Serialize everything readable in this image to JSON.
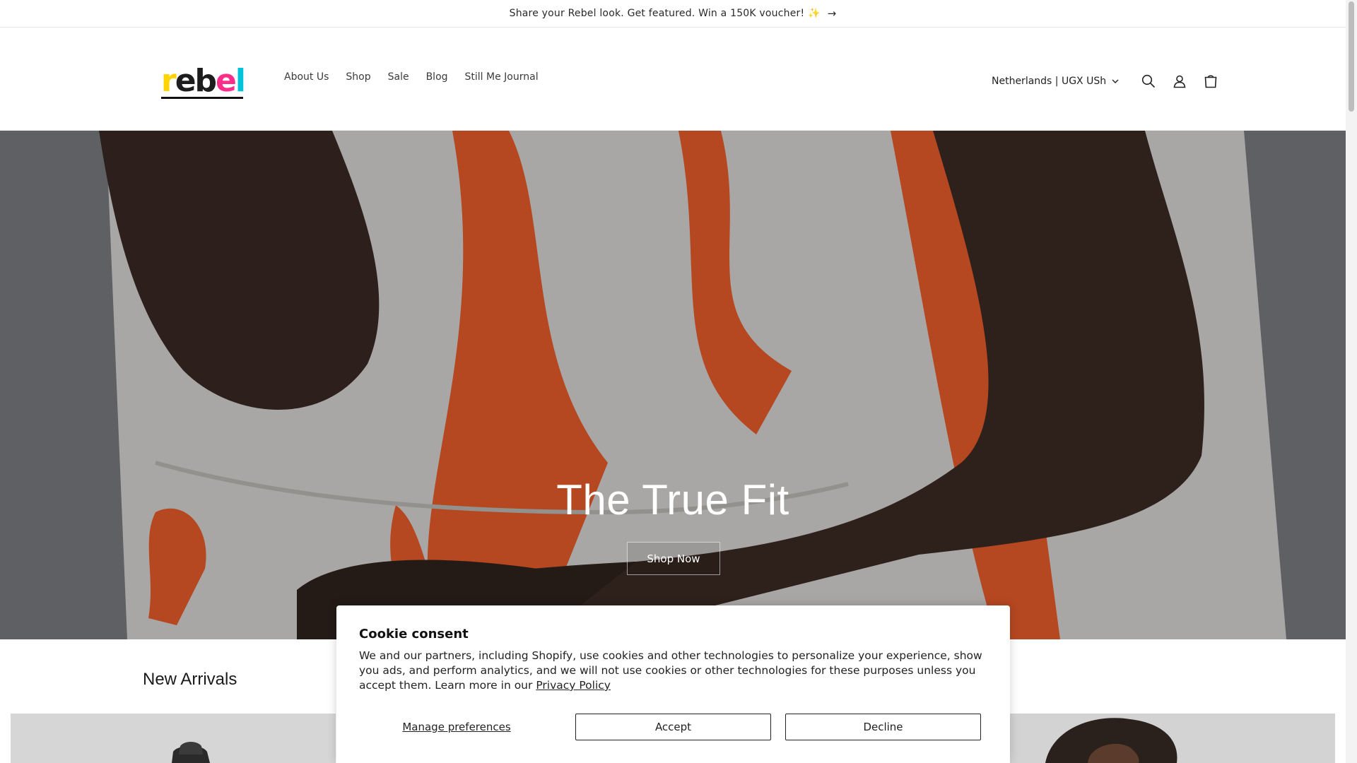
{
  "announcement": {
    "text": "Share your Rebel look. Get featured. Win a 150K voucher! ✨",
    "arrow": "→"
  },
  "header": {
    "logo": {
      "letters": [
        "r",
        "e",
        "b",
        "e",
        "l"
      ],
      "colors": [
        "#ff2e8a",
        "#1d1d1d",
        "#1d1d1d",
        "#ff2e8a",
        "#00c3d9"
      ],
      "accent": "#ffd400"
    },
    "nav": [
      "About Us",
      "Shop",
      "Sale",
      "Blog",
      "Still Me Journal"
    ],
    "locale": "Netherlands | UGX USh",
    "icons": [
      "chevron-down-icon",
      "search-icon",
      "account-icon",
      "cart-icon"
    ]
  },
  "hero": {
    "title": "The True Fit",
    "cta": "Shop Now"
  },
  "section": {
    "title": "New Arrivals"
  },
  "cookie": {
    "title": "Cookie consent",
    "body": "We and our partners, including Shopify, use cookies and other technologies to personalize your experience, show you ads, and perform analytics, and we will not use cookies or other technologies for these purposes unless you accept them. Learn more in our ",
    "link": "Privacy Policy",
    "manage": "Manage preferences",
    "accept": "Accept",
    "decline": "Decline"
  }
}
